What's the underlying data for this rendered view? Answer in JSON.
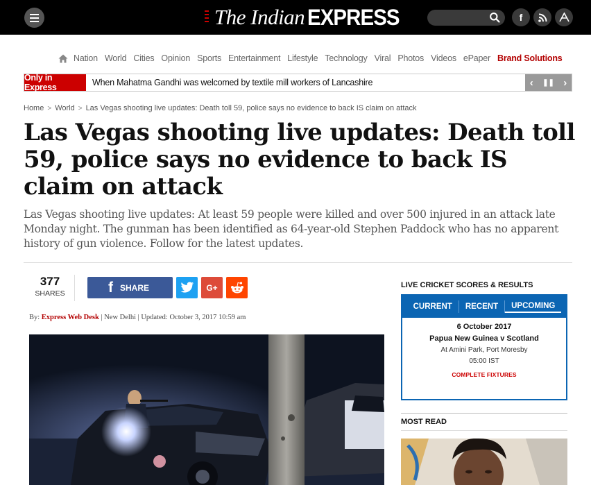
{
  "header": {
    "logo_the": "The Indian",
    "logo_express": "EXPRESS",
    "icons": [
      "menu-icon",
      "search-icon",
      "facebook-icon",
      "rss-icon",
      "font-size-icon"
    ],
    "search_placeholder": ""
  },
  "nav": {
    "items": [
      "Nation",
      "World",
      "Cities",
      "Opinion",
      "Sports",
      "Entertainment",
      "Lifestyle",
      "Technology",
      "Viral",
      "Photos",
      "Videos",
      "ePaper"
    ],
    "brand": "Brand Solutions"
  },
  "ticker": {
    "label": "Only in Express",
    "text": "When Mahatma Gandhi was welcomed by textile mill workers of Lancashire",
    "controls": [
      "‹",
      "❚❚",
      "›"
    ]
  },
  "breadcrumb": {
    "home": "Home",
    "section": "World",
    "current": "Las Vegas shooting live updates: Death toll 59, police says no evidence to back IS claim on attack",
    "sep": ">"
  },
  "article": {
    "headline": "Las Vegas shooting live updates: Death toll 59, police says no evidence to back IS claim on attack",
    "synopsis": "Las Vegas shooting live updates: At least 59 people were killed and over 500 injured in an attack late Monday night. The gunman has been identified as 64-year-old Stephen Paddock who has no apparent history of gun violence. Follow for the latest updates.",
    "shares_count": "377",
    "shares_label": "SHARES",
    "share_button": "SHARE",
    "byline_prefix": "By:",
    "author": "Express Web Desk",
    "location": "New Delhi",
    "updated": "Updated: October 3, 2017 10:59 am",
    "pipe": "|"
  },
  "cricket": {
    "title": "LIVE CRICKET SCORES & RESULTS",
    "tabs": [
      "CURRENT",
      "RECENT",
      "UPCOMING"
    ],
    "active_tab": "UPCOMING",
    "date": "6 October 2017",
    "teams": "Papua New Guinea v Scotland",
    "venue": "At Amini Park, Port Moresby",
    "time": "05:00 IST",
    "link": "COMPLETE FIXTURES"
  },
  "sidebar": {
    "most_read": "MOST READ"
  },
  "colors": {
    "topbar": "#000000",
    "brand_red": "#c00000",
    "facebook": "#3b5998",
    "twitter": "#1da1f2",
    "google_plus": "#dd4b39",
    "reddit": "#ff4500",
    "cricket_blue": "#0b65b3"
  }
}
